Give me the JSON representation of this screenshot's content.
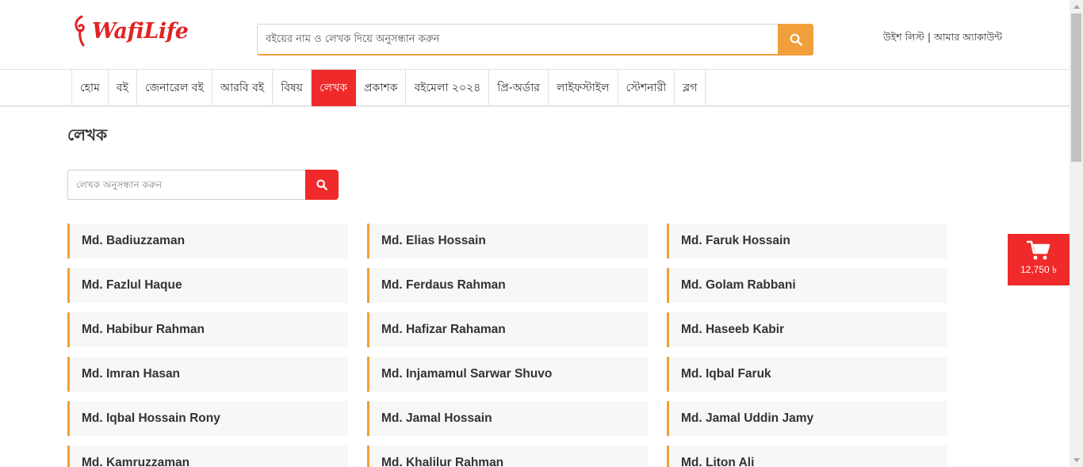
{
  "header": {
    "logo_text": "WafiLife",
    "search_placeholder": "বইয়ের নাম ও লেখক দিয়ে অনুসন্ধান করুন",
    "search_icon": "search-icon",
    "wishlist_label": "উইশ লিস্ট",
    "separator": "|",
    "account_label": "আমার অ্যাকাউন্ট"
  },
  "nav": {
    "items": [
      {
        "label": "হোম"
      },
      {
        "label": "বই"
      },
      {
        "label": "জেনারেল বই"
      },
      {
        "label": "আরবি বই"
      },
      {
        "label": "বিষয়"
      },
      {
        "label": "লেখক"
      },
      {
        "label": "প্রকাশক"
      },
      {
        "label": "বইমেলা ২০২৪"
      },
      {
        "label": "প্রি-অর্ডার"
      },
      {
        "label": "লাইফস্টাইল"
      },
      {
        "label": "স্টেশনারী"
      },
      {
        "label": "ব্লগ"
      }
    ],
    "active": "লেখক"
  },
  "page": {
    "title": "লেখক",
    "author_search_placeholder": "লেখক অনুসন্ধান করুন"
  },
  "authors": [
    "Md. Badiuzzaman",
    "Md. Elias Hossain",
    "Md. Faruk Hossain",
    "Md. Fazlul Haque",
    "Md. Ferdaus Rahman",
    "Md. Golam Rabbani",
    "Md. Habibur Rahman",
    "Md. Hafizar Rahaman",
    "Md. Haseeb Kabir",
    "Md. Imran Hasan",
    "Md. Injamamul Sarwar Shuvo",
    "Md. Iqbal Faruk",
    "Md. Iqbal Hossain Rony",
    "Md. Jamal Hossain",
    "Md. Jamal Uddin Jamy",
    "Md. Kamruzzaman",
    "Md. Khalilur Rahman",
    "Md. Liton Ali"
  ],
  "cart": {
    "icon": "cart-icon",
    "total": "12,750 ৳"
  },
  "colors": {
    "brand_red": "#f02a2a",
    "accent_orange": "#f19f3a"
  }
}
